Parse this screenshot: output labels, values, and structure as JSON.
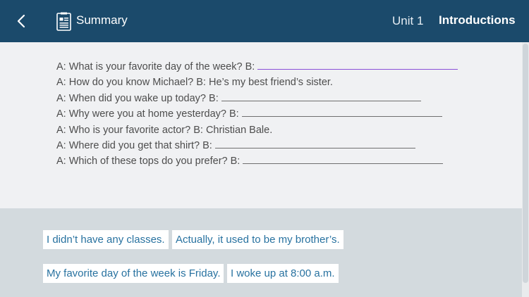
{
  "header": {
    "back_icon": "chevron-left-icon",
    "summary_icon": "document-icon",
    "summary_label": "Summary",
    "unit_label": "Unit 1",
    "lesson_title": "Introductions"
  },
  "exercise": {
    "lines": [
      {
        "question": "A: What is your favorite day of the week? B:",
        "answer": "",
        "blank": true,
        "active": true
      },
      {
        "question": "A: How do you know Michael? B: He’s my best friend’s sister.",
        "answer": "",
        "blank": false,
        "active": false
      },
      {
        "question": "A: When did you wake up today?  B:",
        "answer": "",
        "blank": true,
        "active": false
      },
      {
        "question": "A: Why were you at home yesterday? B:",
        "answer": "",
        "blank": true,
        "active": false
      },
      {
        "question": "A: Who is your favorite actor? B: Christian Bale.",
        "answer": "",
        "blank": false,
        "active": false
      },
      {
        "question": "A: Where did you get that shirt? B:",
        "answer": "",
        "blank": true,
        "active": false
      },
      {
        "question": "A: Which of these tops do you prefer? B:",
        "answer": "",
        "blank": true,
        "active": false
      }
    ]
  },
  "answer_bank": {
    "options": [
      "I didn’t have any classes.",
      "Actually, it used to be my brother’s.",
      "My favorite day of the week is Friday.",
      "I woke up at 8:00 a.m."
    ]
  },
  "colors": {
    "header_bg": "#1b4a6b",
    "active_blank": "#8a4fd8",
    "chip_text": "#2872a0",
    "answer_area_bg": "#d3dade"
  }
}
